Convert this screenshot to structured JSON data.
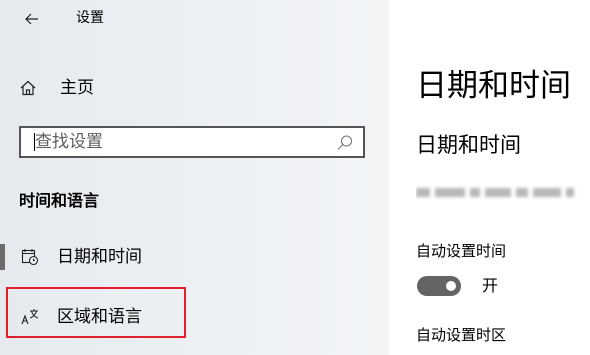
{
  "app": {
    "title": "设置"
  },
  "sidebar": {
    "home_label": "主页",
    "search_placeholder": "查找设置",
    "section_header": "时间和语言",
    "items": [
      {
        "label": "日期和时间",
        "icon": "calendar-clock-icon",
        "selected": true
      },
      {
        "label": "区域和语言",
        "icon": "language-icon",
        "selected": false,
        "highlighted": true
      }
    ]
  },
  "main": {
    "page_title": "日期和时间",
    "section_title": "日期和时间",
    "auto_time": {
      "label": "自动设置时间",
      "state_label": "开",
      "enabled": true
    },
    "auto_timezone": {
      "label": "自动设置时区"
    }
  },
  "colors": {
    "highlight_border": "#e0202a",
    "toggle_on": "#646464",
    "selection_indicator": "#6b6b6b"
  }
}
